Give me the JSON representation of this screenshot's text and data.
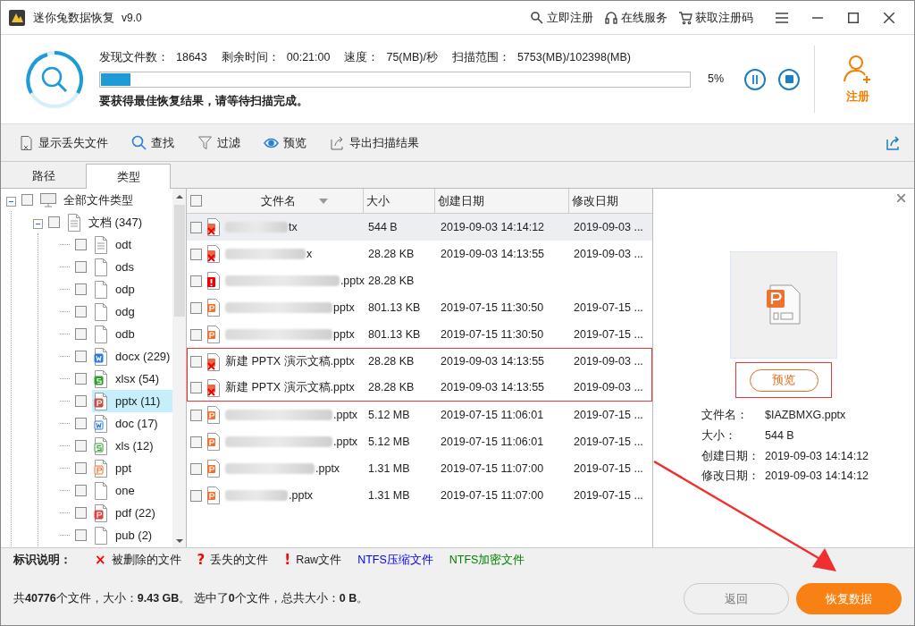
{
  "window": {
    "title": "迷你兔数据恢复",
    "version": "v9.0",
    "links": [
      {
        "kind": "key",
        "label": "立即注册"
      },
      {
        "kind": "headset",
        "label": "在线服务"
      },
      {
        "kind": "cart",
        "label": "获取注册码"
      }
    ]
  },
  "scan": {
    "stats": [
      {
        "label": "发现文件数：",
        "value": "18643"
      },
      {
        "label": "剩余时间：",
        "value": "00:21:00"
      },
      {
        "label": "速度：",
        "value": "75(MB)/秒"
      },
      {
        "label": "扫描范围：",
        "value": "5753(MB)/102398(MB)"
      }
    ],
    "level": 0.05,
    "percent": "5%",
    "message": "要获得最佳恢复结果，请等待扫描完成。",
    "register": "注册"
  },
  "toolbar": [
    {
      "kind": "lost",
      "label": "显示丢失文件"
    },
    {
      "kind": "search",
      "label": "查找"
    },
    {
      "kind": "filter",
      "label": "过滤"
    },
    {
      "kind": "eye",
      "label": "预览"
    },
    {
      "kind": "export",
      "label": "导出扫描结果"
    }
  ],
  "tabs": [
    {
      "label": "路径",
      "selected": false
    },
    {
      "label": "类型",
      "selected": true
    }
  ],
  "tree": [
    {
      "label": "全部文件类型",
      "kind": "computer",
      "checked": false,
      "selected": false,
      "expanded": true,
      "children": [
        {
          "label": "文档 (347)",
          "kind": "blank-lines",
          "checked": false,
          "selected": false,
          "expanded": true,
          "children": [
            {
              "label": "odt",
              "kind": "lines",
              "checked": false,
              "selected": false
            },
            {
              "label": "ods",
              "kind": "blank",
              "checked": false,
              "selected": false
            },
            {
              "label": "odp",
              "kind": "blank",
              "checked": false,
              "selected": false
            },
            {
              "label": "odg",
              "kind": "blank",
              "checked": false,
              "selected": false
            },
            {
              "label": "odb",
              "kind": "blank",
              "checked": false,
              "selected": false
            },
            {
              "label": "docx (229)",
              "kind": "word",
              "checked": false,
              "selected": false
            },
            {
              "label": "xlsx (54)",
              "kind": "sheet",
              "checked": false,
              "selected": false
            },
            {
              "label": "pptx (11)",
              "kind": "slides",
              "checked": false,
              "selected": true
            },
            {
              "label": "doc (17)",
              "kind": "word-outline",
              "checked": false,
              "selected": false
            },
            {
              "label": "xls (12)",
              "kind": "sheet-outline",
              "checked": false,
              "selected": false
            },
            {
              "label": "ppt",
              "kind": "slides-outline",
              "checked": false,
              "selected": false
            },
            {
              "label": "one",
              "kind": "blank",
              "checked": false,
              "selected": false
            },
            {
              "label": "pdf (22)",
              "kind": "pdf",
              "checked": false,
              "selected": false
            },
            {
              "label": "pub (2)",
              "kind": "blank",
              "checked": false,
              "selected": false
            }
          ]
        }
      ]
    }
  ],
  "table": {
    "all_checked": false,
    "columns": [
      "文件名",
      "大小",
      "创建日期",
      "修改日期"
    ],
    "rows": [
      {
        "kind": "deleted",
        "name": "tx",
        "blurred": true,
        "size": "544 B",
        "created": "2019-09-03 14:14:12",
        "modified": "2019-09-03 ...",
        "checked": false,
        "selected": true,
        "highlighted": false
      },
      {
        "kind": "deleted",
        "name": "x",
        "blurred": true,
        "size": "28.28 KB",
        "created": "2019-09-03 14:13:55",
        "modified": "2019-09-03 ...",
        "checked": false,
        "selected": false,
        "highlighted": false
      },
      {
        "kind": "raw",
        "name": ".pptx",
        "blurred": true,
        "size": "28.28 KB",
        "checked": false,
        "selected": false,
        "highlighted": false
      },
      {
        "kind": "normal",
        "name": "pptx",
        "blurred": true,
        "size": "801.13 KB",
        "created": "2019-07-15 11:30:50",
        "modified": "2019-07-15 ...",
        "checked": false,
        "selected": false,
        "highlighted": false
      },
      {
        "kind": "normal",
        "name": "pptx",
        "blurred": true,
        "size": "801.13 KB",
        "created": "2019-07-15 11:30:50",
        "modified": "2019-07-15 ...",
        "checked": false,
        "selected": false,
        "highlighted": false
      },
      {
        "kind": "deleted",
        "name": "新建 PPTX 演示文稿.pptx",
        "blurred": false,
        "size": "28.28 KB",
        "created": "2019-09-03 14:13:55",
        "modified": "2019-09-03 ...",
        "checked": false,
        "selected": false,
        "highlighted": true
      },
      {
        "kind": "deleted",
        "name": "新建 PPTX 演示文稿.pptx",
        "blurred": false,
        "size": "28.28 KB",
        "created": "2019-09-03 14:13:55",
        "modified": "2019-09-03 ...",
        "checked": false,
        "selected": false,
        "highlighted": true
      },
      {
        "kind": "normal",
        "name": ".pptx",
        "blurred": true,
        "size": "5.12 MB",
        "created": "2019-07-15 11:06:01",
        "modified": "2019-07-15 ...",
        "checked": false,
        "selected": false,
        "highlighted": false
      },
      {
        "kind": "normal",
        "name": ".pptx",
        "blurred": true,
        "size": "5.12 MB",
        "created": "2019-07-15 11:06:01",
        "modified": "2019-07-15 ...",
        "checked": false,
        "selected": false,
        "highlighted": false
      },
      {
        "kind": "normal",
        "name": ".pptx",
        "blurred": true,
        "size": "1.31 MB",
        "created": "2019-07-15 11:07:00",
        "modified": "2019-07-15 ...",
        "checked": false,
        "selected": false,
        "highlighted": false
      },
      {
        "kind": "normal",
        "name": ".pptx",
        "blurred": true,
        "size": "1.31 MB",
        "created": "2019-07-15 11:07:00",
        "modified": "2019-07-15 ...",
        "checked": false,
        "selected": false,
        "highlighted": false
      }
    ]
  },
  "preview": {
    "button": "预览",
    "button_highlighted": true,
    "details": [
      {
        "label": "文件名：",
        "value": "$IAZBMXG.pptx"
      },
      {
        "label": "大小：",
        "value": "544 B"
      },
      {
        "label": "创建日期：",
        "value": "2019-09-03 14:14:12"
      },
      {
        "label": "修改日期：",
        "value": "2019-09-03 14:14:12"
      }
    ]
  },
  "legend": {
    "title": "标识说明：",
    "items": [
      {
        "mark": "×",
        "label": "被删除的文件",
        "color": "#ff0000"
      },
      {
        "mark": "?",
        "label": "丢失的文件",
        "color": "#ff0000"
      },
      {
        "mark": "!",
        "label": "Raw文件",
        "color": "#ff0000"
      },
      {
        "label": "NTFS压缩文件",
        "color": "#0000ff"
      },
      {
        "label": "NTFS加密文件",
        "color": "#008000"
      }
    ]
  },
  "status_bar": "共**40776**个文件，大小：**9.43 GB**。 选中了**0**个文件，总共大小：**0 B**。",
  "buttons": [
    {
      "kind": "secondary",
      "label": "返回"
    },
    {
      "kind": "primary",
      "label": "恢复数据"
    }
  ],
  "annotation_arrow": true
}
